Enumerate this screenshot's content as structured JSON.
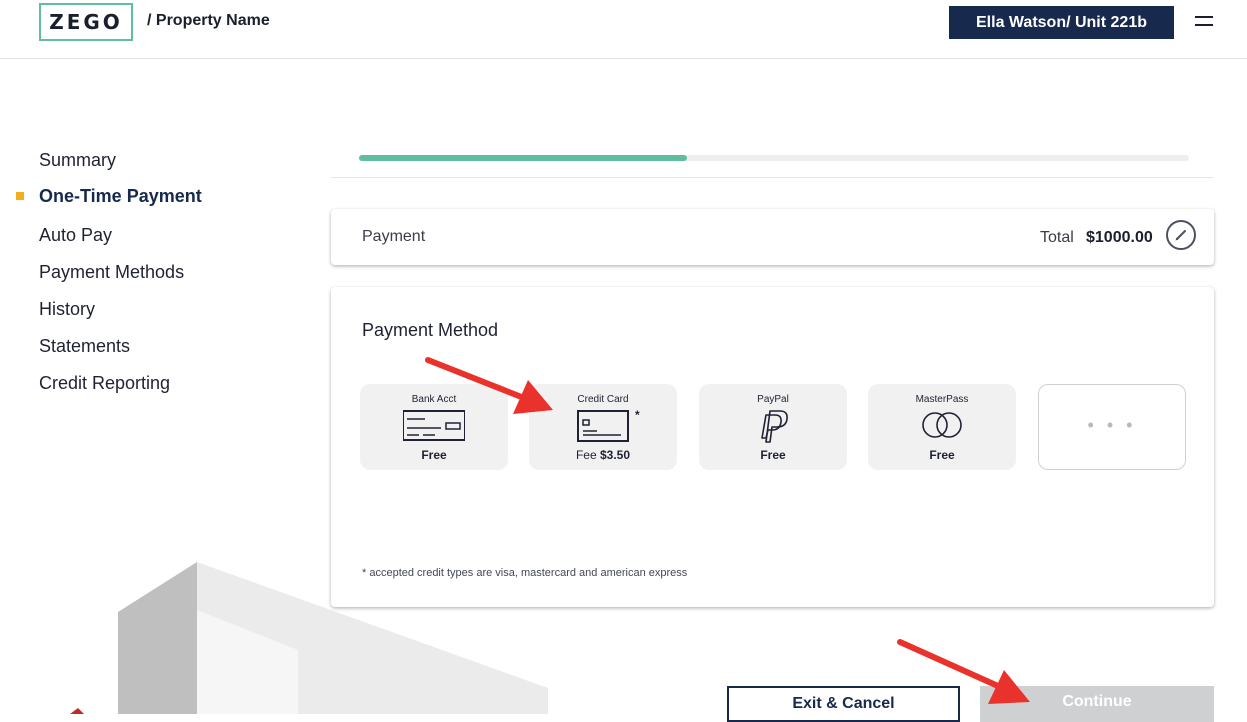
{
  "header": {
    "logo_text": "ZEGO",
    "breadcrumb": "/ Property Name",
    "user_label": "Ella Watson/ Unit 221b",
    "menu_icon": "hamburger-menu-icon"
  },
  "sidebar": {
    "items": [
      {
        "label": "Summary",
        "active": false
      },
      {
        "label": "One-Time Payment",
        "active": true
      },
      {
        "label": "Auto Pay",
        "active": false
      },
      {
        "label": "Payment Methods",
        "active": false
      },
      {
        "label": "History",
        "active": false
      },
      {
        "label": "Statements",
        "active": false
      },
      {
        "label": "Credit Reporting",
        "active": false
      }
    ],
    "active_marker_color": "#f2ae1c"
  },
  "progress": {
    "fraction": 0.395,
    "color": "#5fbf9c"
  },
  "payment": {
    "label": "Payment",
    "total_label": "Total",
    "total_value": "$1000.00",
    "edit_icon": "pencil-icon"
  },
  "payment_method": {
    "title": "Payment Method",
    "options": [
      {
        "label": "Bank Acct",
        "icon": "check-icon",
        "fee": "Free"
      },
      {
        "label": "Credit Card",
        "icon": "credit-card-icon",
        "fee_prefix": "Fee",
        "fee": "$3.50",
        "asterisk": "*"
      },
      {
        "label": "PayPal",
        "icon": "paypal-icon",
        "fee": "Free"
      },
      {
        "label": "MasterPass",
        "icon": "masterpass-icon",
        "fee": "Free"
      }
    ],
    "more_label": "• • •",
    "footnote": "* accepted credit types are visa, mastercard and american express"
  },
  "actions": {
    "exit_label": "Exit & Cancel",
    "continue_label": "Continue"
  },
  "colors": {
    "brand_navy": "#17294d",
    "brand_green": "#5fbf9c",
    "annotation_red": "#e8322b"
  }
}
